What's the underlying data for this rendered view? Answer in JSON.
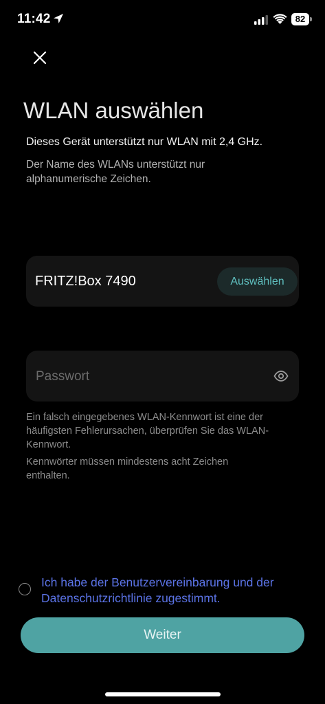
{
  "status_bar": {
    "time": "11:42",
    "battery": "82"
  },
  "header": {
    "title": "WLAN auswählen",
    "subtitle": "Dieses Gerät unterstützt nur WLAN mit 2,4 GHz.",
    "info": "Der Name des WLANs unterstützt nur alphanumerische Zeichen."
  },
  "network": {
    "name": "FRITZ!Box 7490",
    "select_label": "Auswählen"
  },
  "password": {
    "value": "",
    "placeholder": "Passwort"
  },
  "hints": {
    "error_hint": "Ein falsch eingegebenes WLAN-Kennwort ist eine der häufigsten Fehlerursachen, überprüfen Sie das WLAN-Kennwort.",
    "length_hint": "Kennwörter müssen mindestens acht Zeichen enthalten."
  },
  "consent": {
    "text": "Ich habe der Benutzervereinbarung und der Datenschutzrichtlinie zugestimmt.",
    "checked": false
  },
  "actions": {
    "continue_label": "Weiter"
  },
  "colors": {
    "background": "#000000",
    "card": "#141414",
    "accent": "#4fa3a3",
    "link": "#5b73e6"
  },
  "icons": {
    "close": "close-icon",
    "eye": "eye-icon",
    "location": "location-arrow-icon",
    "signal": "cellular-signal-icon",
    "wifi": "wifi-icon",
    "battery": "battery-icon"
  }
}
